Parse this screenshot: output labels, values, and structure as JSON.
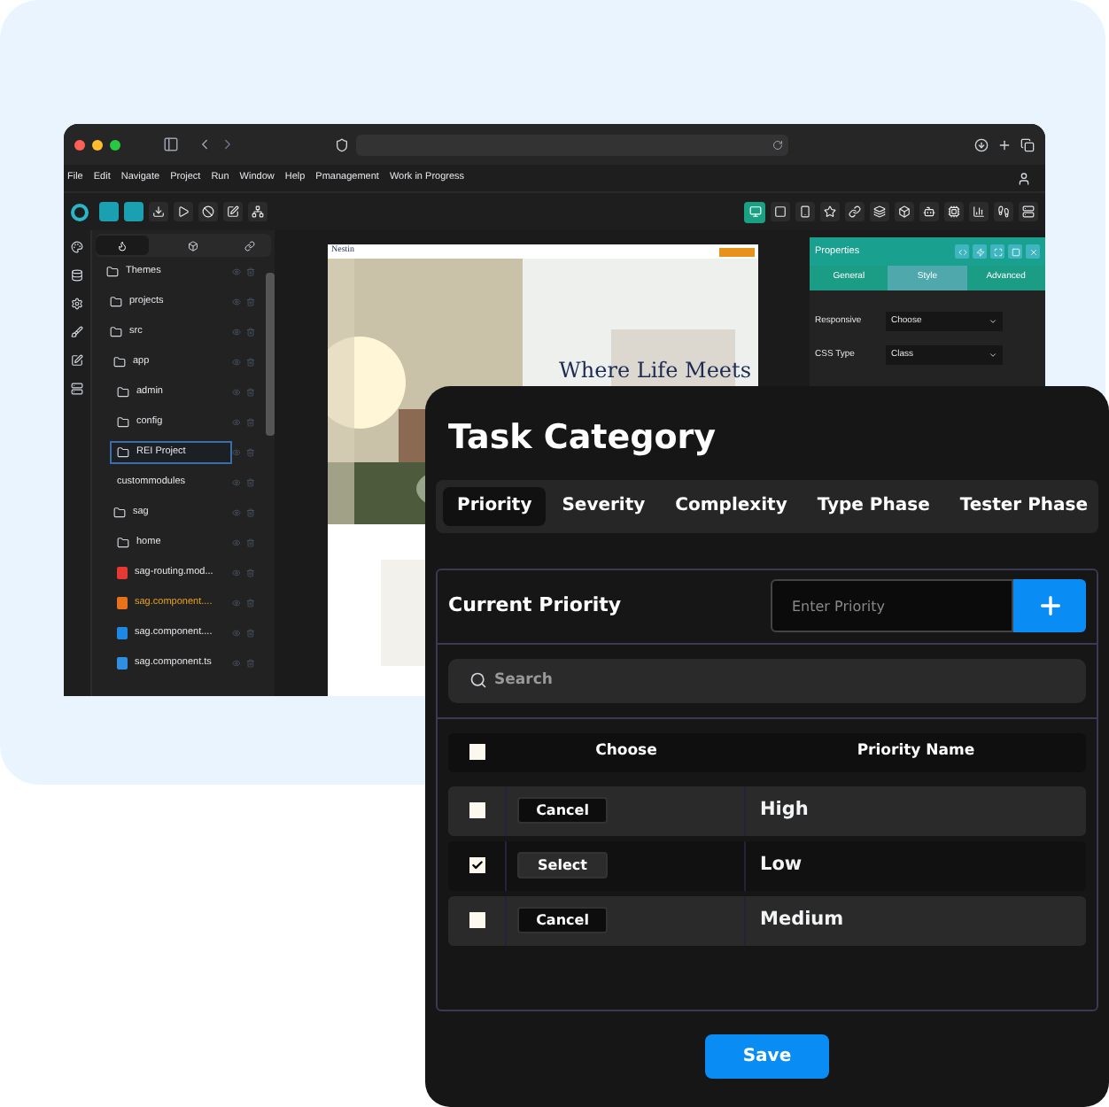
{
  "ide": {
    "menu": [
      "File",
      "Edit",
      "Navigate",
      "Project",
      "Run",
      "Window",
      "Help",
      "Pmanagement",
      "Work in Progress"
    ],
    "tree": [
      {
        "label": "Themes",
        "kind": "folder",
        "selected": false,
        "children": [
          {
            "label": "projects",
            "kind": "folder",
            "selected": false
          },
          {
            "label": "src",
            "kind": "folder",
            "selected": false,
            "children": [
              {
                "label": "app",
                "kind": "folder",
                "selected": false,
                "children": [
                  {
                    "label": "admin",
                    "kind": "folder",
                    "selected": false
                  },
                  {
                    "label": "config",
                    "kind": "folder",
                    "selected": false
                  },
                  {
                    "label": "REI Project",
                    "kind": "folder",
                    "selected": true
                  },
                  {
                    "label": "custommodules",
                    "kind": "plain",
                    "selected": false
                  }
                ]
              },
              {
                "label": "sag",
                "kind": "folder",
                "selected": false,
                "children": [
                  {
                    "label": "home",
                    "kind": "folder",
                    "selected": false
                  },
                  {
                    "label": "sag-routing.mod...",
                    "kind": "file",
                    "color": "#e53935",
                    "selected": false
                  },
                  {
                    "label": "sag.component....",
                    "kind": "file",
                    "color": "#e8711c",
                    "selected": false
                  },
                  {
                    "label": "sag.component....",
                    "kind": "file",
                    "color": "#1e88e5",
                    "selected": false
                  },
                  {
                    "label": "sag.component.ts",
                    "kind": "file",
                    "color": "#2f8fe0",
                    "selected": false
                  }
                ]
              }
            ]
          }
        ]
      }
    ],
    "preview": {
      "brand": "Nestin",
      "headline": "Where Life Meets"
    },
    "properties": {
      "title": "Properties",
      "tabs": [
        {
          "label": "General",
          "selected": false
        },
        {
          "label": "Style",
          "selected": true
        },
        {
          "label": "Advanced",
          "selected": false
        }
      ],
      "fields": [
        {
          "label": "Responsive",
          "value": "Choose"
        },
        {
          "label": "CSS Type",
          "value": "Class"
        }
      ]
    }
  },
  "dialog": {
    "title": "Task Category",
    "tabs": [
      {
        "label": "Priority",
        "selected": true
      },
      {
        "label": "Severity",
        "selected": false
      },
      {
        "label": "Complexity",
        "selected": false
      },
      {
        "label": "Type Phase",
        "selected": false
      },
      {
        "label": "Tester Phase",
        "selected": false
      }
    ],
    "current_label": "Current Priority",
    "input": {
      "placeholder": "Enter Priority"
    },
    "search": {
      "placeholder": "Search"
    },
    "table": {
      "header_checked": false,
      "columns": [
        "Choose",
        "Priority Name"
      ],
      "rows": [
        {
          "checked": false,
          "action": "Cancel",
          "name": "High"
        },
        {
          "checked": true,
          "action": "Select",
          "name": "Low"
        },
        {
          "checked": false,
          "action": "Cancel",
          "name": "Medium"
        }
      ]
    },
    "save": "Save"
  }
}
